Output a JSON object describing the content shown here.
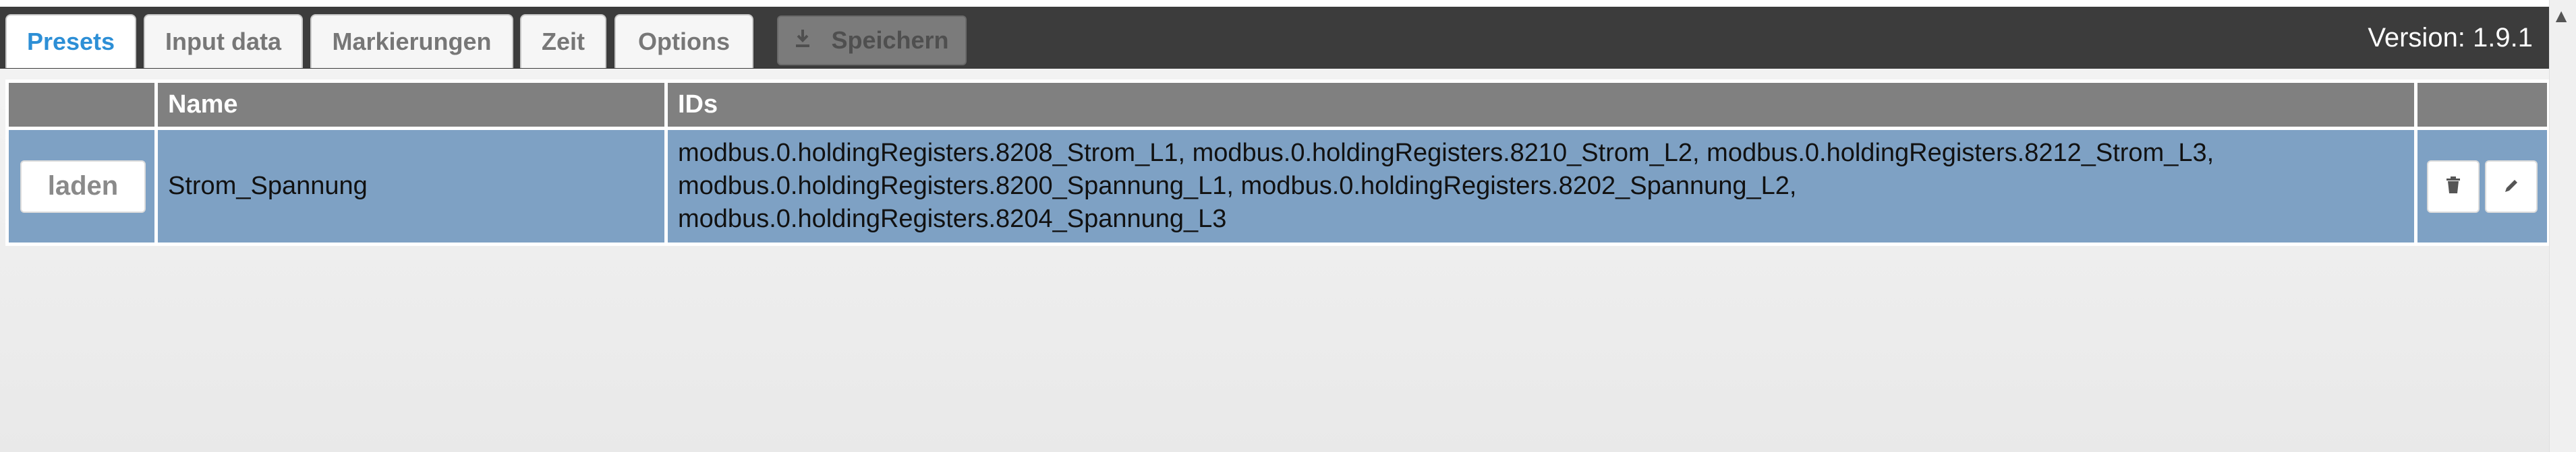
{
  "tabs": [
    {
      "label": "Presets"
    },
    {
      "label": "Input data"
    },
    {
      "label": "Markierungen"
    },
    {
      "label": "Zeit"
    },
    {
      "label": "Options"
    }
  ],
  "toolbar": {
    "save_label": "Speichern",
    "version": "Version: 1.9.1"
  },
  "table": {
    "columns": [
      "",
      "Name",
      "IDs"
    ],
    "rows": [
      {
        "load_label": "laden",
        "name": "Strom_Spannung",
        "ids_lines": [
          "modbus.0.holdingRegisters.8208_Strom_L1, modbus.0.holdingRegisters.8210_Strom_L2, modbus.0.holdingRegisters.8212_Strom_L3,",
          "modbus.0.holdingRegisters.8200_Spannung_L1, modbus.0.holdingRegisters.8202_Spannung_L2,",
          "modbus.0.holdingRegisters.8204_Spannung_L3"
        ]
      }
    ]
  },
  "icons": {
    "save": "download-icon",
    "delete": "trash-icon",
    "edit": "pencil-icon",
    "scroll": "chevron-up-icon"
  },
  "colors": {
    "active_tab_text": "#2d8fd6",
    "toolbar_bg": "#3c3c3c",
    "header_bg": "#808080",
    "selected_row_bg": "#7ea1c4"
  }
}
